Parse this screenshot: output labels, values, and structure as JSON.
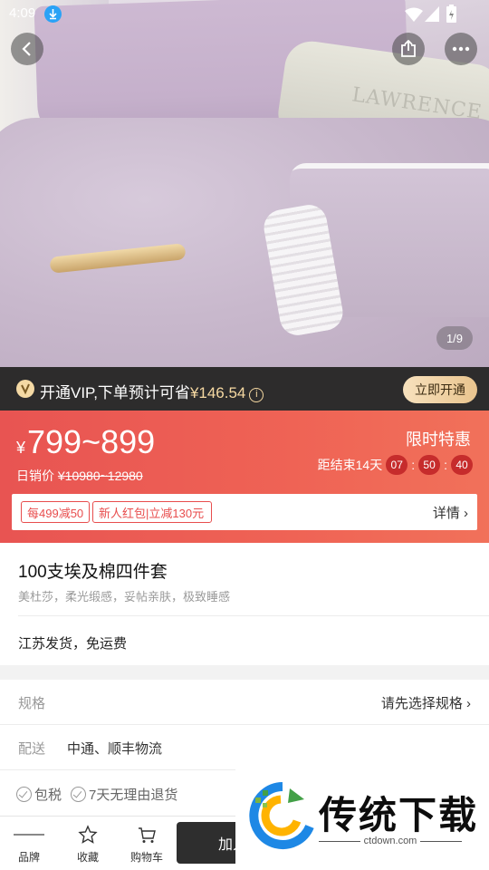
{
  "status_bar": {
    "time": "4:09"
  },
  "hero": {
    "page_indicator": "1/9",
    "pillow_brand_text": "LAWRENCE"
  },
  "vip": {
    "text_prefix": "开通VIP,下单预计可省",
    "amount": "¥146.54",
    "info_glyph": "i",
    "open_button": "立即开通"
  },
  "promo": {
    "currency": "¥",
    "price_range": "799~899",
    "daily_price_label": "日销价",
    "original_price": "¥10980~12980",
    "limited_label": "限时特惠",
    "countdown_label": "距结束14天",
    "hours": "07",
    "minutes": "50",
    "seconds": "40",
    "coupons": [
      "每499减50",
      "新人红包|立减130元"
    ],
    "details_label": "详情",
    "chevron": "›"
  },
  "product": {
    "title": "100支埃及棉四件套",
    "subtitle": "美杜莎，柔光缎感，妥帖亲肤，极致睡感",
    "shipping": "江苏发货，免运费"
  },
  "options": {
    "spec_label": "规格",
    "spec_value": "请先选择规格",
    "delivery_label": "配送",
    "delivery_value": "中通、顺丰物流",
    "guarantees": [
      "包税",
      "7天无理由退货"
    ]
  },
  "bottom_bar": {
    "brand_label": "品牌",
    "favorite_label": "收藏",
    "cart_label": "购物车",
    "add_to_cart": "加入"
  },
  "watermark": {
    "title": "传统下载",
    "url": "ctdown.com"
  },
  "colors": {
    "promo_red": "#e85452",
    "vip_gold": "#f6d9a2",
    "dark": "#2d2c2c"
  }
}
